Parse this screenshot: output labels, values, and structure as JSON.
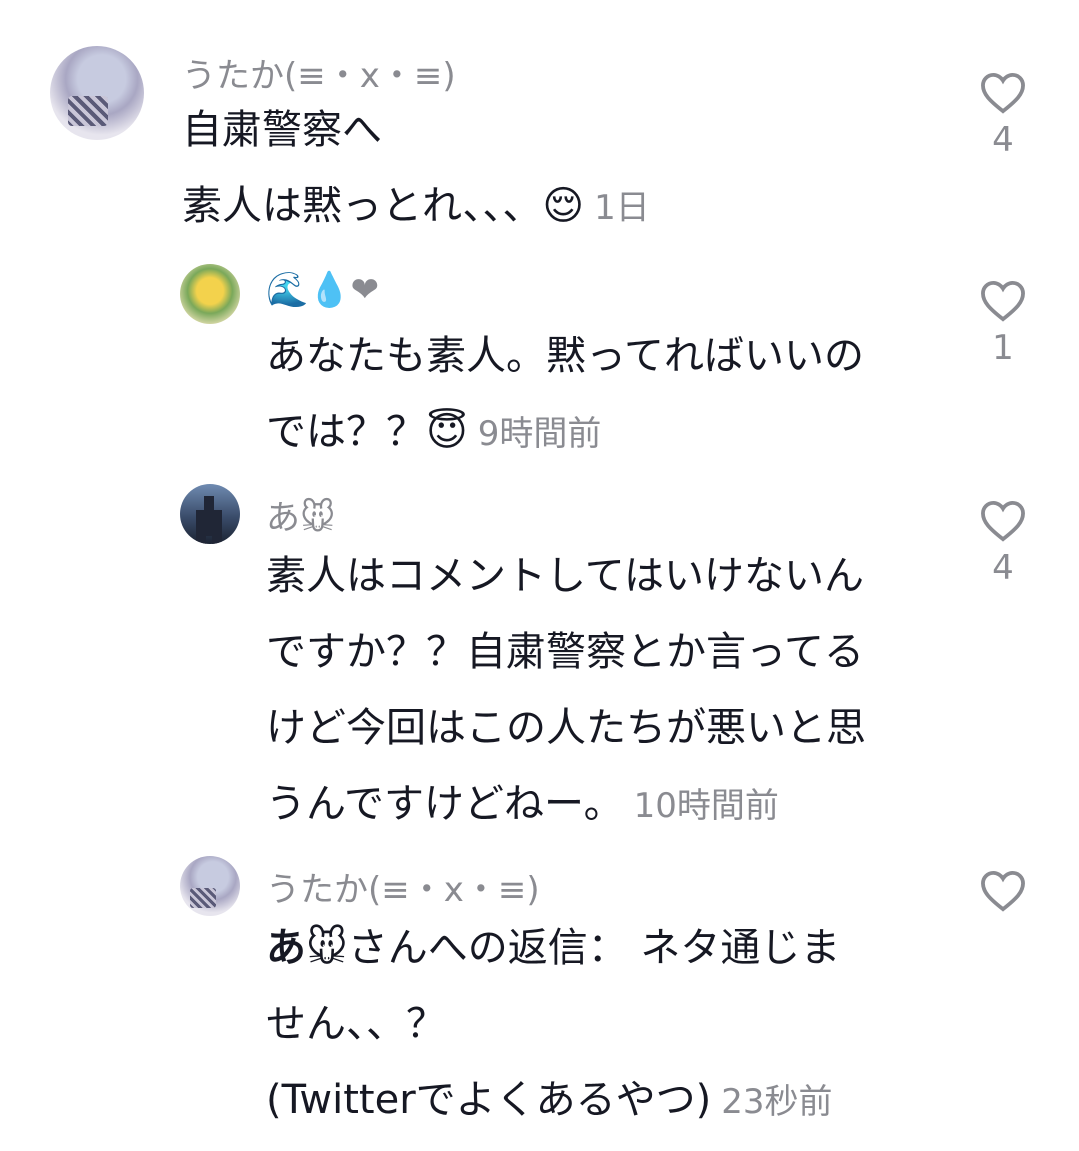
{
  "comments": [
    {
      "username": "うたか(≡・x・≡)",
      "text_lines": [
        "自粛警察へ",
        "素人は黙っとれ、、、"
      ],
      "emoji": "😌",
      "time": "1日",
      "likes": "4",
      "avatar_icon": "avatar-image"
    },
    {
      "username": "🌊💧❤",
      "text_lines": [
        "あなたも素人。黙ってればいいの",
        "では？？"
      ],
      "emoji": "😇",
      "time": "9時間前",
      "likes": "1",
      "avatar_icon": "avatar-image"
    },
    {
      "username": "あ🐭",
      "text_lines": [
        "素人はコメントしてはいけないん",
        "ですか？？自粛警察とか言ってる",
        "けど今回はこの人たちが悪いと思",
        "うんですけどねー。"
      ],
      "time": "10時間前",
      "likes": "4",
      "avatar_icon": "avatar-image"
    },
    {
      "username": "うたか(≡・x・≡)",
      "reply_to": "あ🐭",
      "reply_suffix": "さんへの返信：",
      "text_lines": [
        " ネタ通じま",
        "せん、、？",
        "(Twitterでよくあるやつ)"
      ],
      "time": "23秒前",
      "likes": "",
      "avatar_icon": "avatar-image"
    }
  ],
  "icons": {
    "like": "heart-outline-icon"
  },
  "colors": {
    "text": "#161823",
    "muted": "#8a8b91",
    "background": "#ffffff"
  }
}
